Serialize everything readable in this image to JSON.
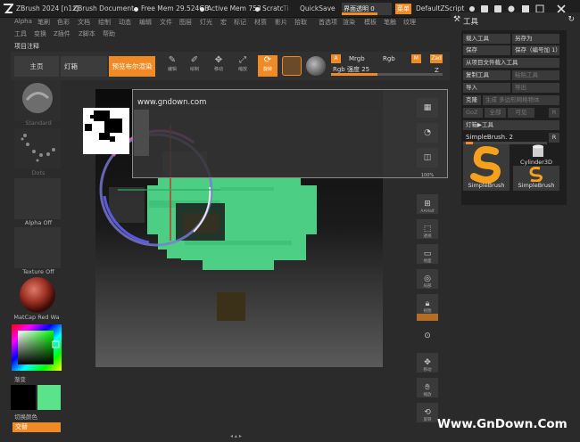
{
  "titlebar": {
    "app_title": "ZBrush 2024 [n1z]",
    "document": "ZBrush Document",
    "free_mem": "Free Mem 29.524GB",
    "active_mem": "Active Mem 753",
    "scratch": "Scratc",
    "timer": "Ti",
    "quicksave": "QuickSave",
    "ui_transparency": "界面透明 0",
    "menu_button": "菜单",
    "script": "DefaultZScript"
  },
  "menubar": {
    "row1": [
      "Alpha",
      "笔刷",
      "色彩",
      "文档",
      "绘制",
      "动态",
      "编辑",
      "文件",
      "图层",
      "灯光",
      "宏",
      "标记",
      "材质",
      "影片",
      "拾取",
      "首选项",
      "渲染",
      "模板",
      "笔触",
      "纹理"
    ],
    "row2": [
      "工具",
      "变换",
      "Z插件",
      "Z脚本",
      "帮助"
    ]
  },
  "note": "项目注释",
  "toolbar": {
    "home": "主页",
    "lightbox": "灯箱",
    "bpr": "预览布尔渲染",
    "icons": [
      {
        "icon": "edit-icon",
        "label": "编辑"
      },
      {
        "icon": "draw-icon",
        "label": "绘制"
      },
      {
        "icon": "move-icon",
        "label": "移动"
      },
      {
        "icon": "scale-icon",
        "label": "缩放"
      },
      {
        "icon": "rotate-icon",
        "label": "旋转"
      }
    ],
    "rgb_a": "A",
    "mrgb": "Mrgb",
    "rgb": "Rgb",
    "m": "M",
    "zadd": "Zad",
    "rgb_intensity": "Rgb 强度 25",
    "z": "Z"
  },
  "left": {
    "standard": "Standard",
    "dots": "Dots",
    "alpha": "Alpha Off",
    "texture": "Texture Off",
    "matcap": "MatCap Red Wa",
    "gradient": "渐变",
    "switch_color": "切换颜色",
    "alternate": "交替",
    "main_color": "#000000",
    "secondary_color": "#5be38c"
  },
  "popup": {
    "url": "www.gndown.com"
  },
  "right_strip": {
    "percent": "100%",
    "aahalf": "AAHalf",
    "buttons": [
      "透视",
      "地面",
      "局部",
      "视图",
      "移动",
      "缩放",
      "旋转"
    ]
  },
  "toolpanel": {
    "title": "工具",
    "load_tool": "载入工具",
    "save_as": "另存为",
    "save": "保存",
    "save_numbered": "保存（编号加 1）",
    "load_from_project": "从项目文件载入工具",
    "copy_tool": "复制工具",
    "paste_tool": "粘贴工具",
    "import": "导入",
    "export": "导出",
    "clone": "克隆",
    "make_polymesh": "生成 多边形网格物体",
    "goz": "GoZ",
    "all": "全部",
    "visible": "可见",
    "r": "R",
    "lightbox_tools": "灯箱▶工具",
    "current_tool": "SimpleBrush. 2",
    "r2": "R",
    "tool1": "SimpleBrush",
    "tool2": "SimpleBrush",
    "cylinder": "Cylinder3D"
  },
  "watermark": "Www.GnDown.Com"
}
